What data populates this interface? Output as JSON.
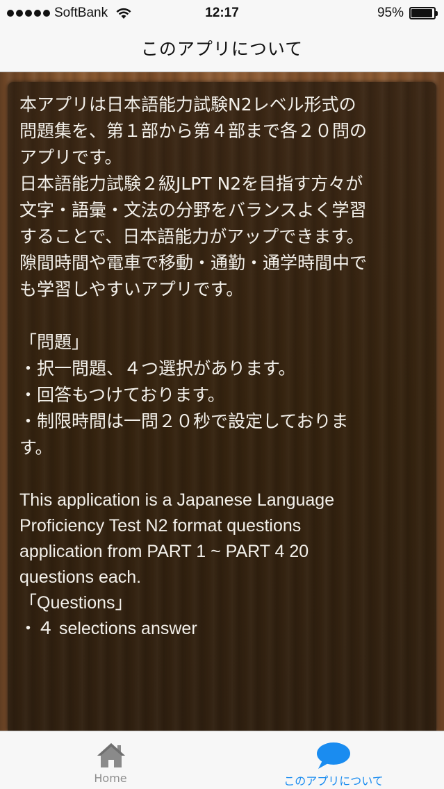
{
  "status_bar": {
    "carrier": "SoftBank",
    "time": "12:17",
    "battery_percent": "95%",
    "battery_level": 0.95
  },
  "nav": {
    "title": "このアプリについて"
  },
  "content": {
    "lines": [
      "本アプリは日本語能力試験N2レベル形式の",
      "問題集を、第１部から第４部まで各２０問の",
      "アプリです。",
      "日本語能力試験２級JLPT N2を目指す方々が",
      "文字・語彙・文法の分野をバランスよく学習",
      "することで、日本語能力がアップできます。",
      "隙間時間や電車で移動・通勤・通学時間中で",
      "も学習しやすいアプリです。",
      "",
      "「問題」",
      "・択一問題、４つ選択があります。",
      "・回答もつけております。",
      "・制限時間は一問２０秒で設定しておりま",
      "す。",
      ""
    ],
    "en_lines": [
      "This application is a Japanese Language",
      "Proficiency Test N2 format questions",
      "application from PART 1 ~ PART 4 20",
      "questions each.",
      "「Questions」",
      "・４ selections answer"
    ]
  },
  "tabs": [
    {
      "label": "Home",
      "icon": "home-icon",
      "active": false
    },
    {
      "label": "このアプリについて",
      "icon": "chat-bubble-icon",
      "active": true
    }
  ],
  "colors": {
    "accent": "#1a8cf0",
    "inactive": "#8e8e8e",
    "text_on_wood": "#f3f0ea"
  }
}
